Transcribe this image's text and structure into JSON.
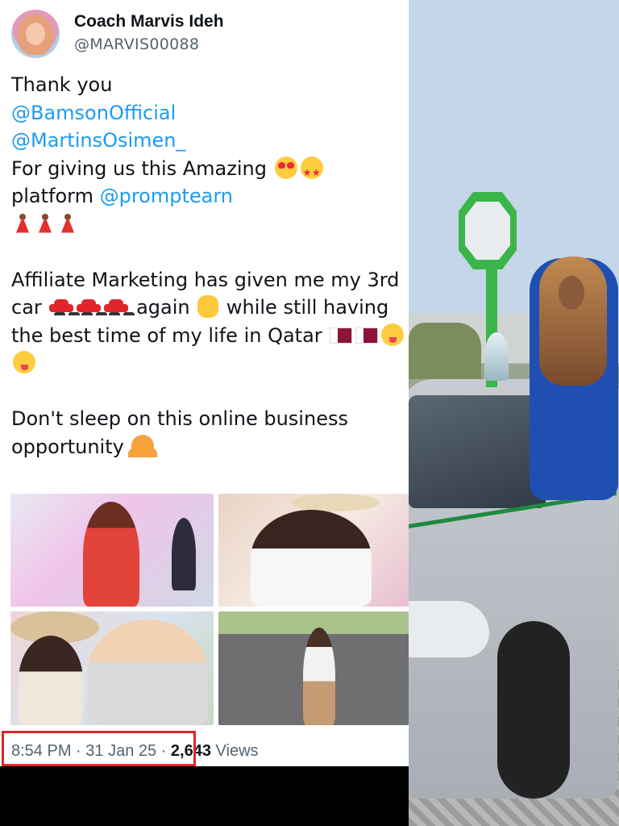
{
  "tweet": {
    "display_name": "Coach Marvis Ideh",
    "handle": "@MARVIS00088",
    "text": {
      "line1": "Thank you",
      "mention1": "@BamsonOfficial",
      "mention2": "@MartinsOsimen_",
      "line4": " For giving us this Amazing",
      "line5_prefix": "platform ",
      "mention3": "@promptearn",
      "line7": "Affiliate Marketing has given me my 3rd",
      "line8_a": "car",
      "line8_b": "again",
      "line8_c": "while still having",
      "line9": "the best time of my life in Qatar",
      "line11": "Don't sleep on this online business",
      "line12": "opportunity"
    },
    "emojis": {
      "line4": [
        "heart-eyes-icon",
        "star-struck-icon"
      ],
      "line6": [
        "dancer-icon",
        "dancer-icon",
        "dancer-icon"
      ],
      "line8": [
        "red-car-icon",
        "red-car-icon",
        "red-car-icon",
        "raising-hands-icon"
      ],
      "line9": [
        "qatar-flag-icon",
        "qatar-flag-icon",
        "yum-face-icon"
      ],
      "line10": [
        "yum-face-icon"
      ],
      "line12": [
        "person-gesturing-no-icon"
      ]
    },
    "footer": {
      "time": "8:54 PM",
      "sep1": " · ",
      "date": "31 Jan 25",
      "sep2": " · ",
      "views_count": "2,643",
      "views_label": " Views"
    }
  },
  "colors": {
    "mention": "#1d9bf0",
    "text": "#0f1419",
    "muted": "#536471",
    "highlight_box": "#e0252b"
  }
}
